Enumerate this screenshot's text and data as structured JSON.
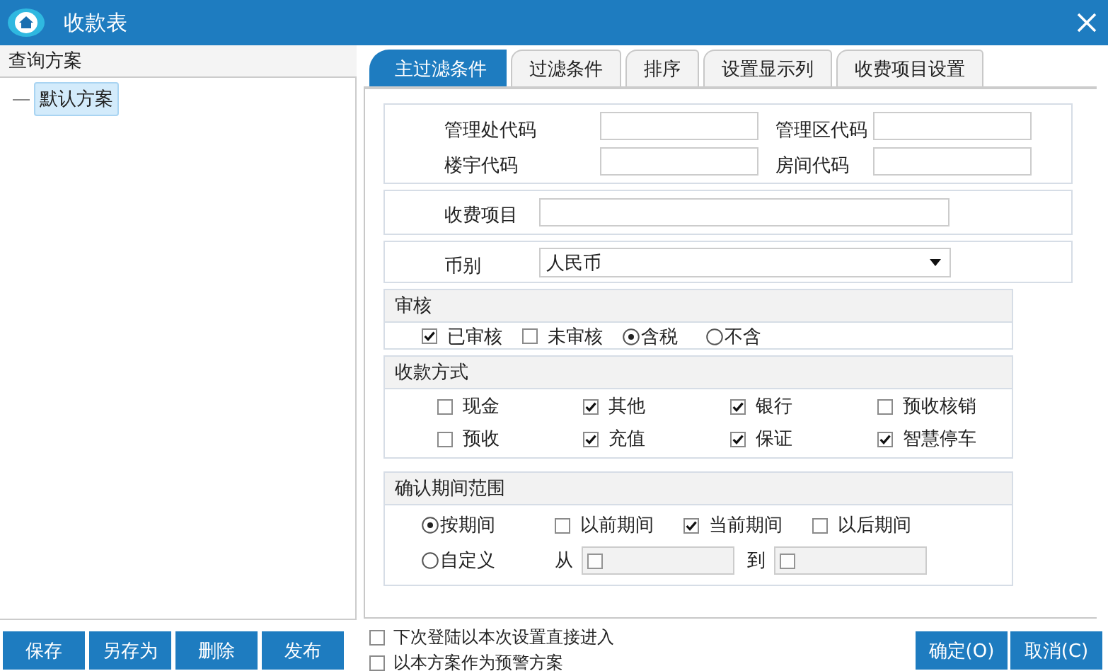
{
  "window": {
    "title": "收款表"
  },
  "scheme_panel": {
    "header": "查询方案",
    "items": [
      {
        "label": "默认方案",
        "selected": true
      }
    ]
  },
  "tabs": [
    {
      "label": "主过滤条件",
      "selected": true
    },
    {
      "label": "过滤条件",
      "selected": false
    },
    {
      "label": "排序",
      "selected": false
    },
    {
      "label": "设置显示列",
      "selected": false
    },
    {
      "label": "收费项目设置",
      "selected": false
    }
  ],
  "code_fields": [
    {
      "label": "管理处代码"
    },
    {
      "label": "管理区代码"
    },
    {
      "label": "楼宇代码"
    },
    {
      "label": "房间代码"
    }
  ],
  "charge_item": {
    "label": "收费项目"
  },
  "currency": {
    "label": "币别",
    "value": "人民币"
  },
  "audit": {
    "title": "审核",
    "options": [
      {
        "kind": "checkbox",
        "label": "已审核",
        "checked": true
      },
      {
        "kind": "checkbox",
        "label": "未审核",
        "checked": false
      },
      {
        "kind": "radio",
        "label": "含税",
        "selected": true
      },
      {
        "kind": "radio",
        "label": "不含",
        "selected": false
      }
    ]
  },
  "payment_methods": {
    "title": "收款方式",
    "items": [
      {
        "label": "现金",
        "checked": false
      },
      {
        "label": "其他",
        "checked": true
      },
      {
        "label": "银行",
        "checked": true
      },
      {
        "label": "预收核销",
        "checked": false
      },
      {
        "label": "预收",
        "checked": false
      },
      {
        "label": "充值",
        "checked": true
      },
      {
        "label": "保证",
        "checked": true
      },
      {
        "label": "智慧停车",
        "checked": true
      }
    ]
  },
  "period": {
    "title": "确认期间范围",
    "modes": [
      {
        "label": "按期间",
        "selected": true
      },
      {
        "label": "自定义",
        "selected": false
      }
    ],
    "period_options": [
      {
        "label": "以前期间",
        "checked": false
      },
      {
        "label": "当前期间",
        "checked": true
      },
      {
        "label": "以后期间",
        "checked": false
      }
    ],
    "range": [
      {
        "label": "从",
        "checked": false,
        "disabled": true
      },
      {
        "label": "到",
        "checked": false,
        "disabled": true
      }
    ]
  },
  "scheme_buttons": [
    "保存",
    "另存为",
    "删除",
    "发布"
  ],
  "options": [
    {
      "label": "下次登陆以本次设置直接进入",
      "checked": false
    },
    {
      "label": "以本方案作为预警方案",
      "checked": false
    }
  ],
  "buttons": [
    "确定(O)",
    "取消(C)"
  ]
}
